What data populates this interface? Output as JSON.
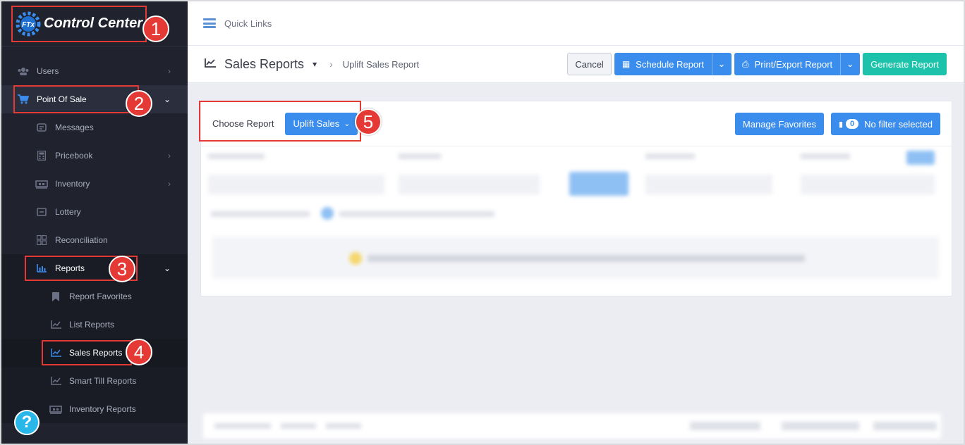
{
  "app": {
    "title": "Control Center",
    "logo_mark": "FTx"
  },
  "sidebar": {
    "items": [
      {
        "label": "Users",
        "icon": "users-icon"
      },
      {
        "label": "Point Of Sale",
        "icon": "cart-icon"
      },
      {
        "label": "Messages",
        "icon": "message-icon"
      },
      {
        "label": "Pricebook",
        "icon": "calculator-icon"
      },
      {
        "label": "Inventory",
        "icon": "pallet-icon"
      },
      {
        "label": "Lottery",
        "icon": "ticket-icon"
      },
      {
        "label": "Reconciliation",
        "icon": "grid-icon"
      },
      {
        "label": "Reports",
        "icon": "bar-chart-icon"
      },
      {
        "label": "Report Favorites",
        "icon": "bookmark-icon"
      },
      {
        "label": "List Reports",
        "icon": "line-chart-icon"
      },
      {
        "label": "Sales Reports",
        "icon": "line-chart-icon"
      },
      {
        "label": "Smart Till Reports",
        "icon": "line-chart-icon"
      },
      {
        "label": "Inventory Reports",
        "icon": "pallet-icon"
      }
    ],
    "help_glyph": "?"
  },
  "annotations": [
    "1",
    "2",
    "3",
    "4",
    "5"
  ],
  "quicklinks": {
    "label": "Quick Links"
  },
  "header": {
    "title": "Sales Reports",
    "breadcrumb": "Uplift Sales Report",
    "cancel": "Cancel",
    "schedule": "Schedule Report",
    "print": "Print/Export Report",
    "generate": "Generate Report"
  },
  "report": {
    "choose_label": "Choose Report",
    "selected": "Uplift Sales",
    "manage_favorites": "Manage Favorites",
    "filter_count": "0",
    "filter_label": "No filter selected"
  },
  "colors": {
    "accent": "#3a8dec",
    "teal": "#1cc3aa",
    "sidebar_bg": "#20222d",
    "highlight": "#e53935"
  }
}
